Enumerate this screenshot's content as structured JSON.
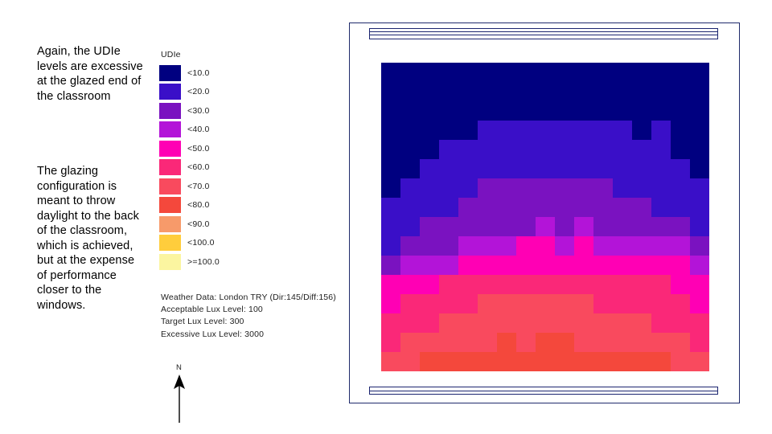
{
  "commentary": {
    "paragraph_1": "Again, the UDIe levels are excessive at the glazed end of the classroom",
    "paragraph_2": "The glazing configuration is meant to throw daylight to the back of the classroom, which is achieved, but at the expense of performance closer to the windows."
  },
  "legend": {
    "title": "UDIe",
    "entries": [
      {
        "label": "<10.0",
        "color": "#000080"
      },
      {
        "label": "<20.0",
        "color": "#3a0fc8"
      },
      {
        "label": "<30.0",
        "color": "#7a12c0"
      },
      {
        "label": "<40.0",
        "color": "#b314d8"
      },
      {
        "label": "<50.0",
        "color": "#ff00b4"
      },
      {
        "label": "<60.0",
        "color": "#fa2878"
      },
      {
        "label": "<70.0",
        "color": "#f94a5e"
      },
      {
        "label": "<80.0",
        "color": "#f4483c"
      },
      {
        "label": "<90.0",
        "color": "#f79a6a"
      },
      {
        "label": "<100.0",
        "color": "#ffcd3c"
      },
      {
        "label": ">=100.0",
        "color": "#fbf5a0"
      }
    ]
  },
  "metadata": {
    "line_1": "Weather Data: London TRY (Dir:145/Diff:156)",
    "line_2": "Acceptable Lux Level: 100",
    "line_3": "Target Lux Level: 300",
    "line_4": "Excessive Lux Level: 3000"
  },
  "north": {
    "label": "N"
  },
  "chart_data": {
    "type": "heatmap",
    "title": "UDIe",
    "xlabel": "",
    "ylabel": "",
    "legend_position": "left",
    "grid": false,
    "colorbar_labels": [
      "<10.0",
      "<20.0",
      "<30.0",
      "<40.0",
      "<50.0",
      "<60.0",
      "<70.0",
      "<80.0",
      "<90.0",
      "<100.0",
      ">=100.0"
    ],
    "colorbar_colors": [
      "#000080",
      "#3a0fc8",
      "#7a12c0",
      "#b314d8",
      "#ff00b4",
      "#fa2878",
      "#f94a5e",
      "#f4483c",
      "#f79a6a",
      "#ffcd3c",
      "#fbf5a0"
    ],
    "bin_upper_bounds": [
      10,
      20,
      30,
      40,
      50,
      60,
      70,
      80,
      90,
      100,
      110
    ],
    "rows": 16,
    "cols": 17,
    "description": "Useful Daylight Illuminance (excessive) plan grid of a classroom; glazing runs along the top and bottom edges of the plan. Values are bin indices 0-10 matching colorbar_labels.",
    "values": [
      [
        0,
        0,
        0,
        0,
        0,
        0,
        0,
        0,
        0,
        0,
        0,
        0,
        0,
        0,
        0,
        0,
        0
      ],
      [
        0,
        0,
        0,
        0,
        0,
        0,
        0,
        0,
        0,
        0,
        0,
        0,
        0,
        0,
        0,
        0,
        0
      ],
      [
        0,
        0,
        0,
        0,
        0,
        0,
        0,
        0,
        0,
        0,
        0,
        0,
        0,
        0,
        0,
        0,
        0
      ],
      [
        0,
        0,
        0,
        0,
        0,
        1,
        1,
        1,
        1,
        1,
        1,
        1,
        1,
        0,
        1,
        0,
        0
      ],
      [
        0,
        0,
        0,
        1,
        1,
        1,
        1,
        1,
        1,
        1,
        1,
        1,
        1,
        1,
        1,
        0,
        0
      ],
      [
        0,
        0,
        1,
        1,
        1,
        1,
        1,
        1,
        1,
        1,
        1,
        1,
        1,
        1,
        1,
        1,
        0
      ],
      [
        0,
        1,
        1,
        1,
        1,
        2,
        2,
        2,
        2,
        2,
        2,
        2,
        1,
        1,
        1,
        1,
        1
      ],
      [
        1,
        1,
        1,
        1,
        2,
        2,
        2,
        2,
        2,
        2,
        2,
        2,
        2,
        2,
        1,
        1,
        1
      ],
      [
        1,
        1,
        2,
        2,
        2,
        2,
        2,
        2,
        3,
        2,
        3,
        2,
        2,
        2,
        2,
        2,
        1
      ],
      [
        1,
        2,
        2,
        2,
        3,
        3,
        3,
        4,
        4,
        3,
        4,
        3,
        3,
        3,
        3,
        3,
        2
      ],
      [
        2,
        3,
        3,
        3,
        4,
        4,
        4,
        4,
        4,
        4,
        4,
        4,
        4,
        4,
        4,
        4,
        3
      ],
      [
        4,
        4,
        4,
        5,
        5,
        5,
        5,
        5,
        5,
        5,
        5,
        5,
        5,
        5,
        5,
        4,
        4
      ],
      [
        4,
        5,
        5,
        5,
        5,
        6,
        6,
        6,
        6,
        6,
        6,
        5,
        5,
        5,
        5,
        5,
        4
      ],
      [
        5,
        5,
        5,
        6,
        6,
        6,
        6,
        6,
        6,
        6,
        6,
        6,
        6,
        6,
        5,
        5,
        5
      ],
      [
        5,
        6,
        6,
        6,
        6,
        6,
        7,
        6,
        7,
        7,
        6,
        6,
        6,
        6,
        6,
        6,
        5
      ],
      [
        6,
        6,
        7,
        7,
        7,
        7,
        7,
        7,
        7,
        7,
        7,
        7,
        7,
        7,
        7,
        6,
        6
      ]
    ]
  }
}
